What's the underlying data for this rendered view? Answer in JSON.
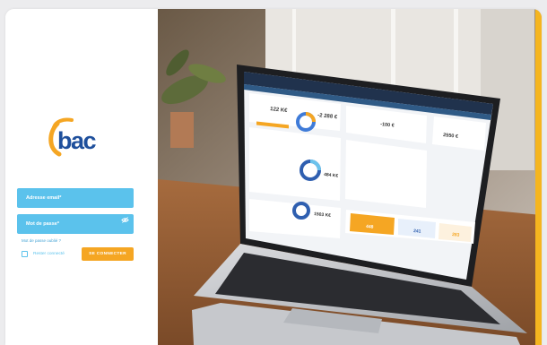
{
  "brand": {
    "logo_text": "bac"
  },
  "login": {
    "email_placeholder": "Adresse email*",
    "password_placeholder": "Mot de passe*",
    "forgot_password": "Mot de passe oublié ?",
    "remember_me": "Rester connecté",
    "submit_label": "SE CONNECTER"
  },
  "dashboard_preview": {
    "header_title": "bac",
    "kpis": [
      "122 K€",
      "-2 288 €",
      "-100 €",
      "2550 €"
    ],
    "donut_values": [
      "484 K€",
      "1503 K€"
    ],
    "tiles": [
      "448",
      "241",
      "283"
    ]
  },
  "colors": {
    "accent_blue": "#5bc2ec",
    "accent_orange": "#f5a623",
    "logo_blue": "#1e4f9c",
    "logo_orange": "#f5a623"
  },
  "icons": [
    "eye-icon",
    "checkbox-icon"
  ]
}
